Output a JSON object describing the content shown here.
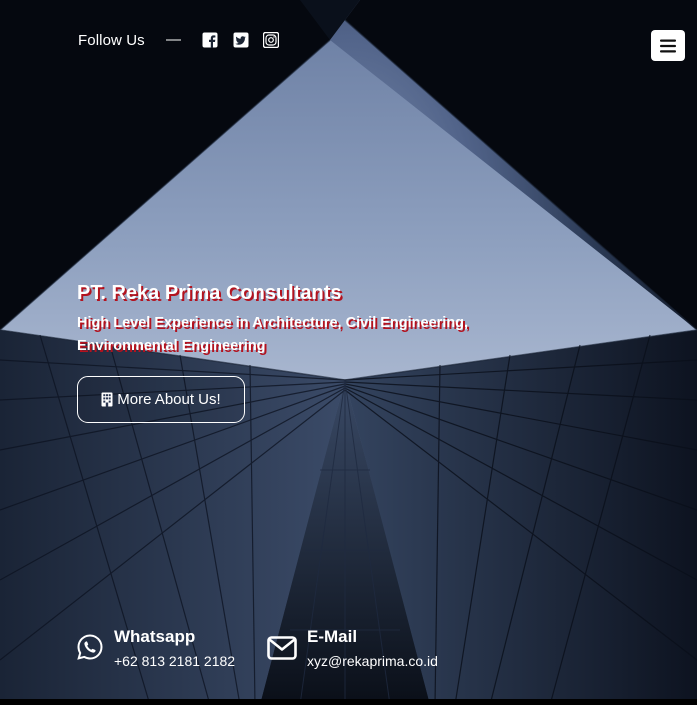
{
  "header": {
    "follow_label": "Follow Us",
    "separator": "—",
    "social": [
      {
        "name": "facebook-icon"
      },
      {
        "name": "twitter-icon"
      },
      {
        "name": "instagram-icon"
      }
    ],
    "menu_icon": "hamburger-menu-icon"
  },
  "hero": {
    "title": "PT. Reka Prima Consultants",
    "subtitle": "High Level Experience in Architecture, Civil Engineering, Environmental Engineering",
    "button_label": "More About Us!",
    "button_icon": "building-icon"
  },
  "contacts": {
    "whatsapp": {
      "title": "Whatsapp",
      "value": "+62 813 2181 2182",
      "icon": "whatsapp-icon"
    },
    "email": {
      "title": "E-Mail",
      "value": "xyz@rekaprima.co.id",
      "icon": "envelope-icon"
    }
  },
  "colors": {
    "text": "#ffffff",
    "title_shadow": "#b3121e",
    "sky": "#7d8faf",
    "background": "#0b0f17"
  }
}
